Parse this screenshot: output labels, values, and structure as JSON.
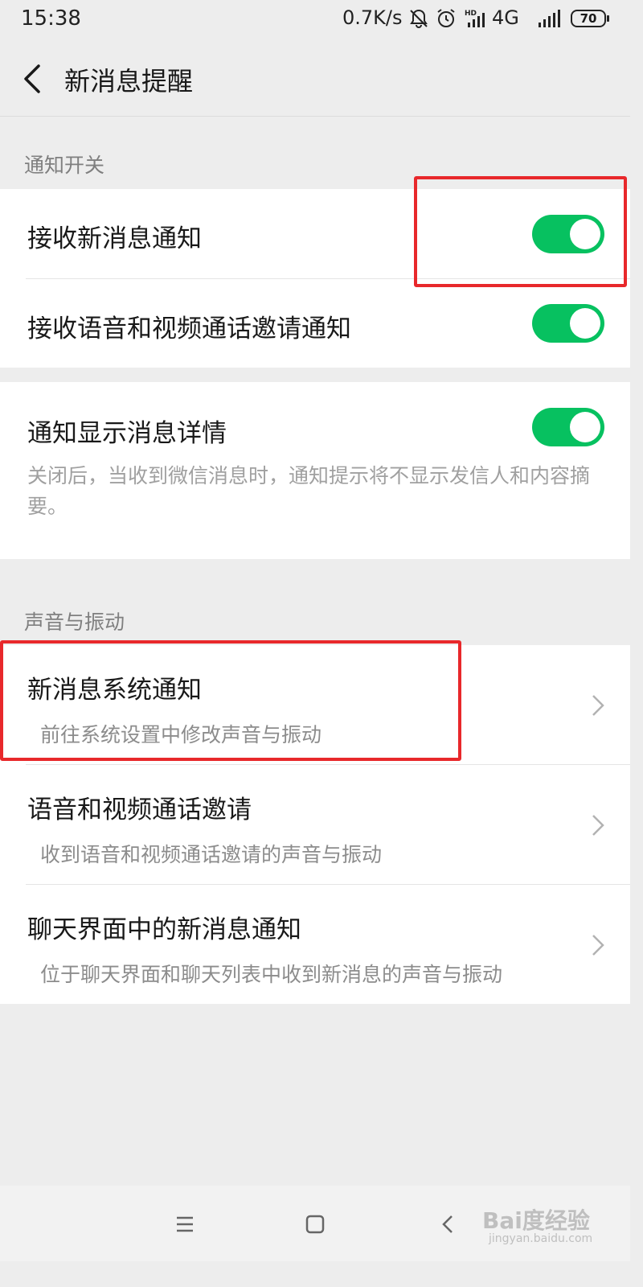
{
  "status_bar": {
    "time": "15:38",
    "speed": "0.7K/s",
    "network": "4G",
    "battery": "70"
  },
  "header": {
    "title": "新消息提醒"
  },
  "sections": {
    "notify": {
      "header": "通知开关",
      "receive_new": {
        "label": "接收新消息通知",
        "enabled": true
      },
      "receive_call": {
        "label": "接收语音和视频通话邀请通知",
        "enabled": true
      },
      "show_detail": {
        "label": "通知显示消息详情",
        "enabled": true,
        "description": "关闭后，当收到微信消息时，通知提示将不显示发信人和内容摘要。"
      }
    },
    "sound": {
      "header": "声音与振动",
      "system_notify": {
        "label": "新消息系统通知",
        "sub": "前往系统设置中修改声音与振动"
      },
      "call_invite": {
        "label": "语音和视频通话邀请",
        "sub": "收到语音和视频通话邀请的声音与振动"
      },
      "chat_notify": {
        "label": "聊天界面中的新消息通知",
        "sub": "位于聊天界面和聊天列表中收到新消息的声音与振动"
      }
    }
  },
  "watermark": {
    "text": "Bai度经验",
    "sub": "jingyan.baidu.com"
  },
  "colors": {
    "accent": "#07c160",
    "highlight": "#e8282b",
    "background": "#ededed"
  }
}
